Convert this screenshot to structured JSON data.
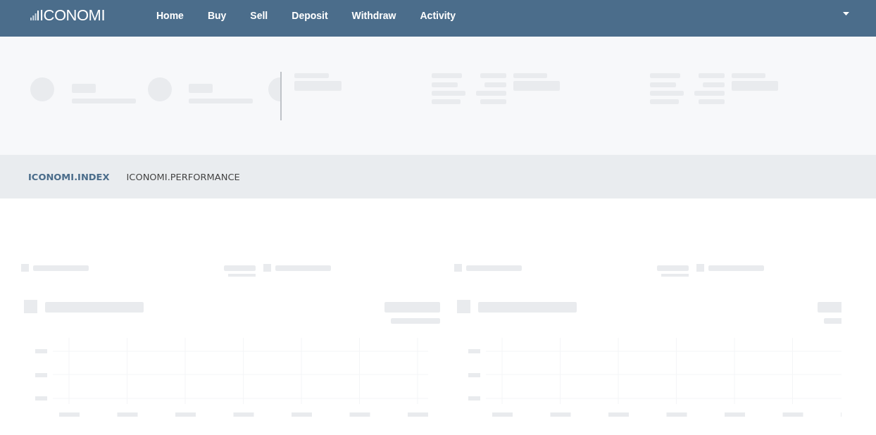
{
  "logo": {
    "text": "ICONOMI"
  },
  "nav": [
    {
      "label": "Home"
    },
    {
      "label": "Buy"
    },
    {
      "label": "Sell"
    },
    {
      "label": "Deposit"
    },
    {
      "label": "Withdraw"
    },
    {
      "label": "Activity"
    }
  ],
  "tabs": [
    {
      "label": "ICONOMI.INDEX",
      "selected": true
    },
    {
      "label": "ICONOMI.PERFORMANCE",
      "selected": false
    }
  ]
}
